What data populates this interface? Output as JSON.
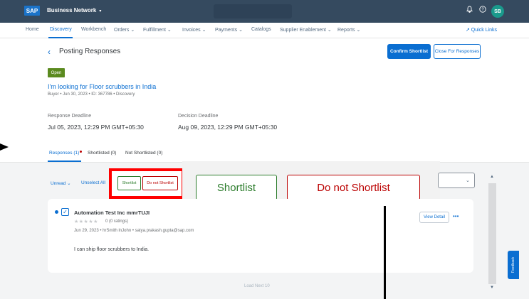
{
  "header": {
    "logo": "SAP",
    "product": "Business Network",
    "product_caret": "▾",
    "bell": "🔔",
    "help": "?",
    "avatar_initials": "SB"
  },
  "nav": {
    "items": [
      "Home",
      "Discovery",
      "Workbench",
      "Orders ⌄",
      "Fulfillment ⌄",
      "Invoices ⌄",
      "Payments ⌄",
      "Catalogs",
      "Supplier Enablement ⌄",
      "Reports ⌄"
    ],
    "active_index": 1,
    "quick_links": "↗ Quick Links"
  },
  "page": {
    "back": "‹",
    "title": "Posting Responses",
    "confirm_shortlist": "Confirm Shortlist",
    "close_responses": "Close For Responses"
  },
  "rfq": {
    "status": "Open",
    "title": "I'm looking for Floor scrubbers in India",
    "meta": "Buyer • Jun 30, 2023 • ID: 367786 • Discovery"
  },
  "deadlines": {
    "response_label": "Response Deadline",
    "response_value": "Jul 05, 2023, 12:29 PM GMT+05:30",
    "decision_label": "Decision Deadline",
    "decision_value": "Aug 09, 2023, 12:29 PM GMT+05:30"
  },
  "tabs": {
    "responses": "Responses (1)",
    "shortlisted": "Shortlisted (0)",
    "not_shortlisted": "Not Shortlisted (0)"
  },
  "toolbar": {
    "unread": "Unread ⌄",
    "unselect_all": "Unselect All",
    "shortlist": "Shortlist",
    "do_not_shortlist": "Do not Shortlist",
    "sort_caret": "⌄"
  },
  "zoom": {
    "shortlist": "Shortlist",
    "do_not_shortlist": "Do not Shortlist"
  },
  "response": {
    "check": "✓",
    "supplier": "Automation Test Inc mmrTUJI",
    "stars": "★★★★★",
    "rating": "0 (0 ratings)",
    "meta": "Jun 29, 2023 • hrSmith lnJohn • satya.prakash.gupta@sap.com",
    "message": "I can ship floor scrubbers to India.",
    "view_detail": "View Detail",
    "more": "•••"
  },
  "footer": {
    "load_next": "Load Next 10",
    "feedback": "Feedback",
    "scroll_up": "▲",
    "scroll_down": "▼"
  }
}
